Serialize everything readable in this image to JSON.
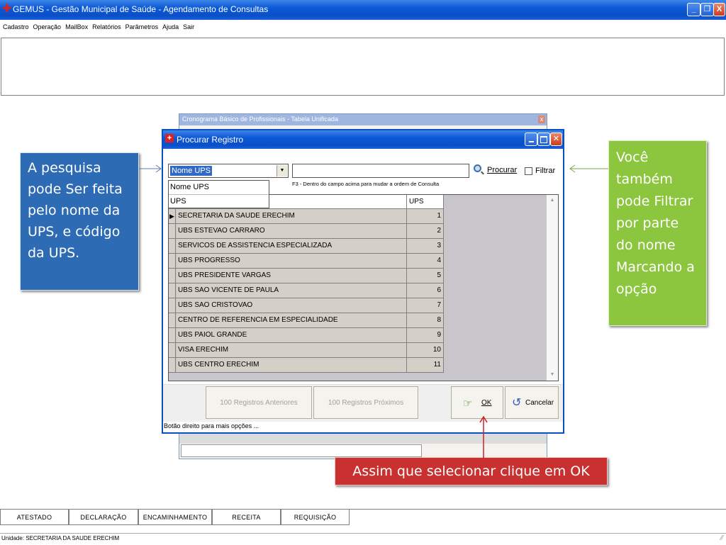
{
  "app": {
    "title": "GEMUS - Gestão Municipal de Saúde - Agendamento de Consultas",
    "menu": [
      "Cadastro",
      "Operação",
      "MailBox",
      "Relatórios",
      "Parâmetros",
      "Ajuda",
      "Sair"
    ],
    "window_buttons": {
      "minimize": "_",
      "restore": "❐",
      "close": "X"
    }
  },
  "background_window": {
    "title": "Cronograma Básico de Profissionais - Tabela Unificada",
    "close": "x"
  },
  "dialog": {
    "title": "Procurar Registro",
    "search_field_select": "Nome UPS",
    "dropdown_options": [
      "Nome UPS",
      "UPS"
    ],
    "search_input_value": "",
    "search_button": "Procurar",
    "filter_checkbox": "Filtrar",
    "hint": "F3 - Dentro do campo acima para mudar a ordem de Consulta",
    "grid_header_code": "UPS",
    "rows": [
      {
        "name": "SECRETARIA DA SAUDE ERECHIM",
        "code": "1"
      },
      {
        "name": "UBS ESTEVAO CARRARO",
        "code": "2"
      },
      {
        "name": "SERVICOS DE ASSISTENCIA ESPECIALIZADA",
        "code": "3"
      },
      {
        "name": "UBS PROGRESSO",
        "code": "4"
      },
      {
        "name": "UBS PRESIDENTE VARGAS",
        "code": "5"
      },
      {
        "name": "UBS SAO VICENTE DE PAULA",
        "code": "6"
      },
      {
        "name": "UBS SAO CRISTOVAO",
        "code": "7"
      },
      {
        "name": "CENTRO DE REFERENCIA EM ESPECIALIDADE",
        "code": "8"
      },
      {
        "name": "UBS PAIOL GRANDE",
        "code": "9"
      },
      {
        "name": "VISA ERECHIM",
        "code": "10"
      },
      {
        "name": "UBS CENTRO ERECHIM",
        "code": "11"
      }
    ],
    "prev_button": "100 Registros Anteriores",
    "next_button": "100 Registros Próximos",
    "ok_button": "OK",
    "cancel_button": "Cancelar",
    "status": "Botão direito para mais opções ..."
  },
  "callouts": {
    "left": "A pesquisa pode Ser feita pelo nome da UPS, e código da UPS.",
    "right": "Você também pode Filtrar por parte do nome Marcando a opção",
    "bottom": "Assim que selecionar clique em OK",
    "left_color": "#2e6bb5",
    "right_color": "#8cc63f",
    "bottom_color": "#c8312f"
  },
  "bottom_tabs": [
    "ATESTADO",
    "DECLARAÇÃO",
    "ENCAMINHAMENTO",
    "RECEITA",
    "REQUISIÇÃO"
  ],
  "statusbar": "Unidade: SECRETARIA DA SAUDE ERECHIM"
}
